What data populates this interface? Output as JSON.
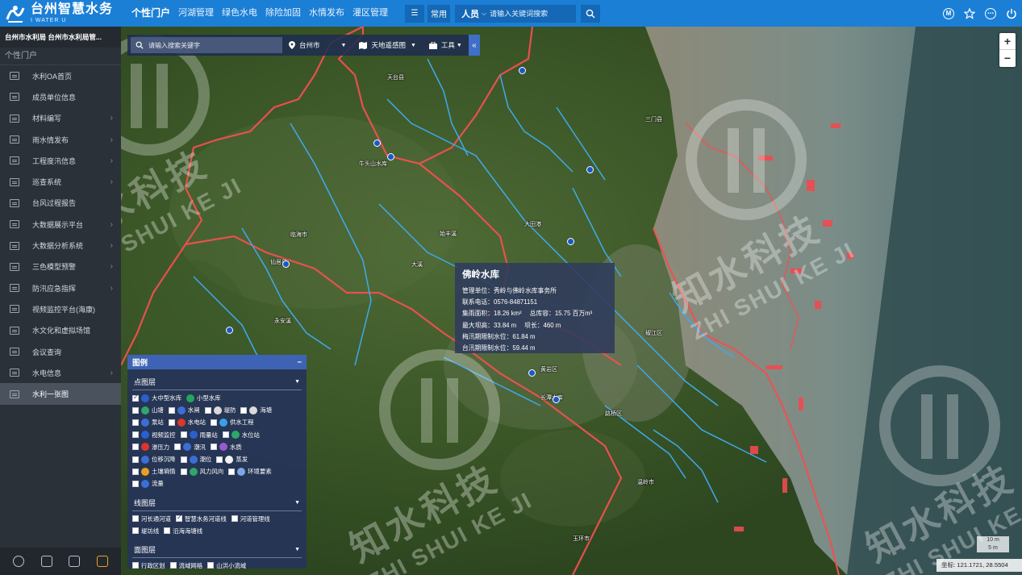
{
  "app": {
    "title": "台州智慧水务",
    "subtitle": "I WATER U"
  },
  "nav": [
    {
      "label": "个性门户",
      "active": true
    },
    {
      "label": "河湖管理"
    },
    {
      "label": "绿色水电"
    },
    {
      "label": "除险加固"
    },
    {
      "label": "水情发布"
    },
    {
      "label": "灌区管理"
    }
  ],
  "toolbar": {
    "common_label": "常用",
    "search_scope": "人员",
    "search_placeholder": "请输入关键词搜索"
  },
  "top_right_icons": [
    "user-m-icon",
    "star-icon",
    "more-icon",
    "power-icon"
  ],
  "sidebar": {
    "org": "台州市水利局  台州市水利局管...",
    "section": "个性门户",
    "items": [
      {
        "label": "水利OA首页",
        "arrow": false
      },
      {
        "label": "成员单位信息",
        "arrow": false
      },
      {
        "label": "材料编写",
        "arrow": true
      },
      {
        "label": "雨水情发布",
        "arrow": true
      },
      {
        "label": "工程度汛信息",
        "arrow": true
      },
      {
        "label": "巡查系统",
        "arrow": true
      },
      {
        "label": "台风过程报告",
        "arrow": false
      },
      {
        "label": "大数据展示平台",
        "arrow": true
      },
      {
        "label": "大数据分析系统",
        "arrow": true
      },
      {
        "label": "三色模型预警",
        "arrow": true
      },
      {
        "label": "防汛应急指挥",
        "arrow": true
      },
      {
        "label": "视频监控平台(海康)",
        "arrow": false
      },
      {
        "label": "水文化和虚拟场馆",
        "arrow": false
      },
      {
        "label": "会议查询",
        "arrow": false
      },
      {
        "label": "水电信息",
        "arrow": true
      },
      {
        "label": "水利一张图",
        "arrow": false,
        "active": true
      }
    ],
    "bottom_icons": [
      "gear-icon",
      "lock-icon",
      "shirt-icon",
      "speaker-icon"
    ]
  },
  "map_toolbar": {
    "search_placeholder": "请输入搜索关键字",
    "region": "台州市",
    "basemap": "天地遥感图",
    "tools": "工具",
    "collapse": "«"
  },
  "zoom": {
    "in": "+",
    "out": "−"
  },
  "popup": {
    "title": "佛岭水库",
    "rows": [
      [
        "管理单位：秀岭与佛岭水库事务所"
      ],
      [
        "联系电话：0576-84871151"
      ],
      [
        "集雨面积：18.26 km²",
        "总库容：15.75 百万m³"
      ],
      [
        "最大坝高：33.84 m",
        "坝长：460 m"
      ],
      [
        "梅汛期限制水位：61.84 m"
      ],
      [
        "台汛期限制水位：59.44 m"
      ]
    ]
  },
  "legend": {
    "title": "图例",
    "close": "−",
    "point_title": "点图层",
    "point_rows": [
      [
        {
          "label": "大中型水库",
          "on": true,
          "color": "#2a5fd0"
        },
        {
          "label": "小型水库",
          "on": false,
          "color": "#25a55a",
          "nocb": true
        }
      ],
      [
        {
          "label": "山塘",
          "on": false,
          "color": "#2ea76b"
        },
        {
          "label": "水闸",
          "on": false,
          "color": "#3a6fd8"
        },
        {
          "label": "堤防",
          "on": false,
          "color": "#d9d9d9"
        },
        {
          "label": "海塘",
          "on": false,
          "color": "#d9d9d9"
        }
      ],
      [
        {
          "label": "泵站",
          "on": false,
          "color": "#3a6fd8"
        },
        {
          "label": "水电站",
          "on": false,
          "color": "#e0342b"
        },
        {
          "label": "供水工程",
          "on": false,
          "color": "#3aa0e8"
        }
      ],
      [
        {
          "label": "视频监控",
          "on": false,
          "color": "#2a5fd0"
        },
        {
          "label": "雨量站",
          "on": false,
          "color": "#2a5fd0"
        },
        {
          "label": "水位站",
          "on": false,
          "color": "#2ea76b"
        }
      ],
      [
        {
          "label": "渗压力",
          "on": false,
          "color": "#e0342b"
        },
        {
          "label": "潮汛",
          "on": false,
          "color": "#3a6fd8"
        },
        {
          "label": "水质",
          "on": false,
          "color": "#9b59d0"
        }
      ],
      [
        {
          "label": "位移沉降",
          "on": false,
          "color": "#3a6fd8"
        },
        {
          "label": "潮位",
          "on": false,
          "color": "#3a6fd8"
        },
        {
          "label": "蒸发",
          "on": false,
          "color": "#f2f2f2"
        }
      ],
      [
        {
          "label": "土壤墒情",
          "on": false,
          "color": "#e8a020"
        },
        {
          "label": "风力风向",
          "on": false,
          "color": "#2ea76b"
        },
        {
          "label": "环境要素",
          "on": false,
          "color": "#7da6e8"
        }
      ],
      [
        {
          "label": "流量",
          "on": false,
          "color": "#3a6fd8"
        }
      ]
    ],
    "line_title": "线图层",
    "line_rows": [
      [
        {
          "label": "河长通河道",
          "on": false
        },
        {
          "label": "智慧水务河道线",
          "on": true
        },
        {
          "label": "河道管理线",
          "on": false
        }
      ],
      [
        {
          "label": "堤坊线",
          "on": false
        },
        {
          "label": "沿海海塘线",
          "on": false
        }
      ]
    ],
    "area_title": "面图层",
    "area_rows": [
      [
        {
          "label": "行政区划",
          "on": false
        },
        {
          "label": "流域网格",
          "on": false
        },
        {
          "label": "山洪小流域",
          "on": false
        }
      ]
    ]
  },
  "scale": {
    "value": "10 m",
    "unit": "5 m"
  },
  "coord": "坐标: 121.1721, 28.5504",
  "watermark": {
    "cn": "知水科技",
    "en": "ZHI SHUI KE JI"
  },
  "map_labels": [
    "天台县",
    "临海市",
    "仙居县",
    "黄岩区",
    "椒江区",
    "路桥区",
    "温岭市",
    "玉环市",
    "三门县",
    "大田港",
    "永安溪",
    "始丰溪",
    "牛头山水库",
    "长潭水库",
    "大溪"
  ]
}
